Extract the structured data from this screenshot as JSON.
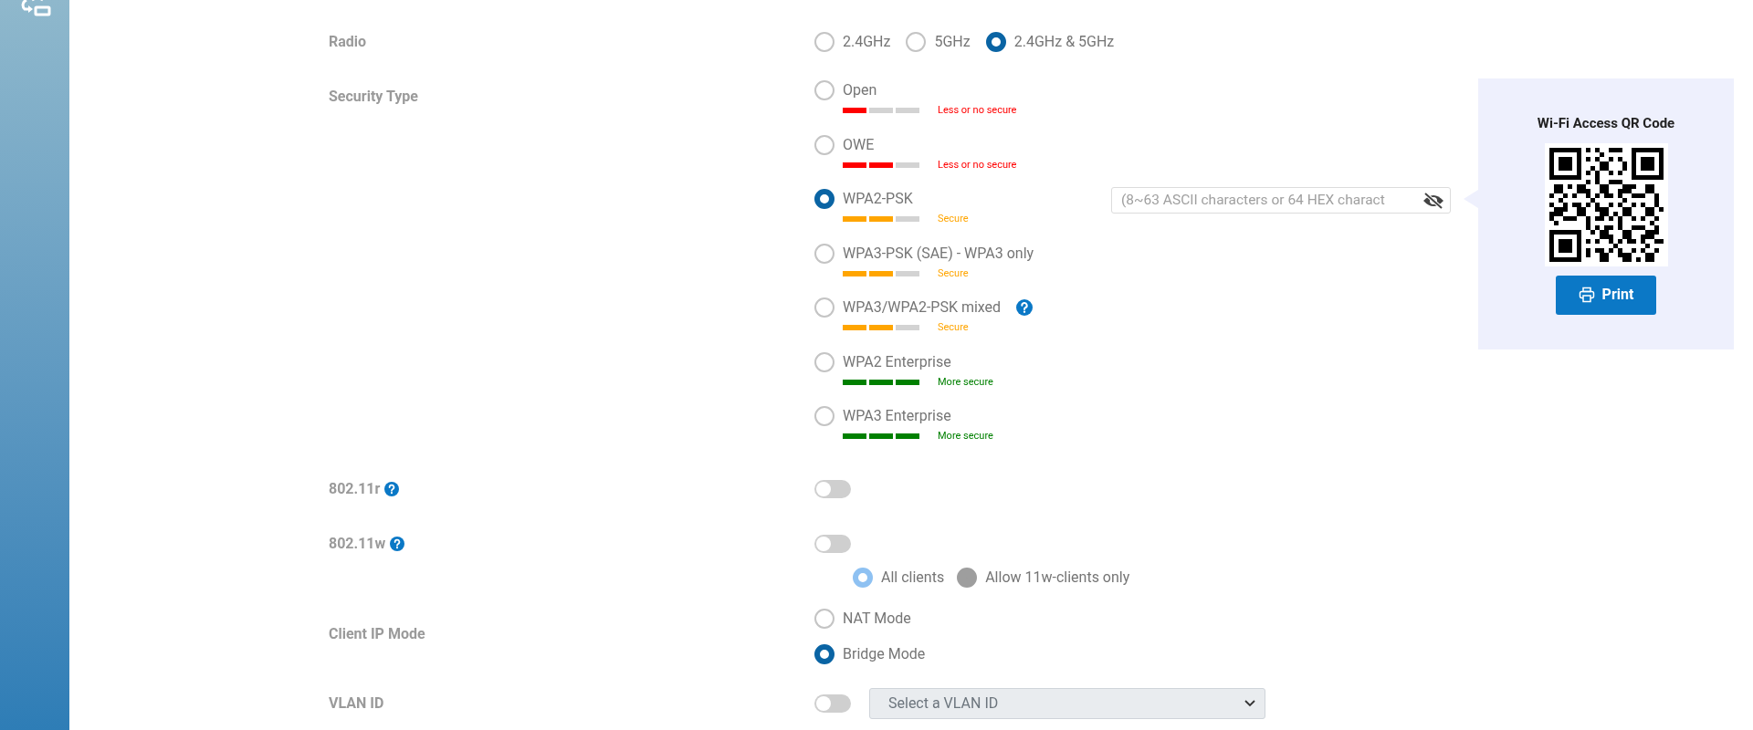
{
  "radio": {
    "label": "Radio",
    "options": [
      {
        "label": "2.4GHz",
        "selected": false
      },
      {
        "label": "5GHz",
        "selected": false
      },
      {
        "label": "2.4GHz & 5GHz",
        "selected": true
      }
    ]
  },
  "security_type": {
    "label": "Security Type",
    "options": [
      {
        "label": "Open",
        "selected": false,
        "level": 0.33,
        "color": "#ff0000",
        "rating": "Less or no secure",
        "help": false
      },
      {
        "label": "OWE",
        "selected": false,
        "level": 0.67,
        "color": "#ff0000",
        "rating": "Less or no secure",
        "help": false
      },
      {
        "label": "WPA2-PSK",
        "selected": true,
        "level": 0.67,
        "color": "#ffa500",
        "rating": "Secure",
        "help": false
      },
      {
        "label": "WPA3-PSK (SAE) - WPA3 only",
        "selected": false,
        "level": 0.67,
        "color": "#ffa500",
        "rating": "Secure",
        "help": false
      },
      {
        "label": "WPA3/WPA2-PSK mixed",
        "selected": false,
        "level": 0.67,
        "color": "#ffa500",
        "rating": "Secure",
        "help": true
      },
      {
        "label": "WPA2 Enterprise",
        "selected": false,
        "level": 1,
        "color": "#008000",
        "rating": "More secure",
        "help": false
      },
      {
        "label": "WPA3 Enterprise",
        "selected": false,
        "level": 1,
        "color": "#008000",
        "rating": "More secure",
        "help": false
      }
    ]
  },
  "password": {
    "placeholder": "(8~63 ASCII characters or 64 HEX charact"
  },
  "qr_panel": {
    "title": "Wi-Fi Access QR Code",
    "print_button": "Print"
  },
  "fast_roaming": {
    "label": "802.11r",
    "on": false
  },
  "pmf": {
    "label": "802.11w",
    "on": false,
    "options": [
      {
        "label": "All clients",
        "selected": true,
        "disabled": true
      },
      {
        "label": "Allow 11w-clients only",
        "selected": false,
        "disabled": true
      }
    ]
  },
  "client_ip_mode": {
    "label": "Client IP Mode",
    "options": [
      {
        "label": "NAT Mode",
        "selected": false
      },
      {
        "label": "Bridge Mode",
        "selected": true
      }
    ]
  },
  "vlan_id": {
    "label": "VLAN ID",
    "on": false,
    "value": "Select a VLAN ID",
    "disabled": true
  }
}
